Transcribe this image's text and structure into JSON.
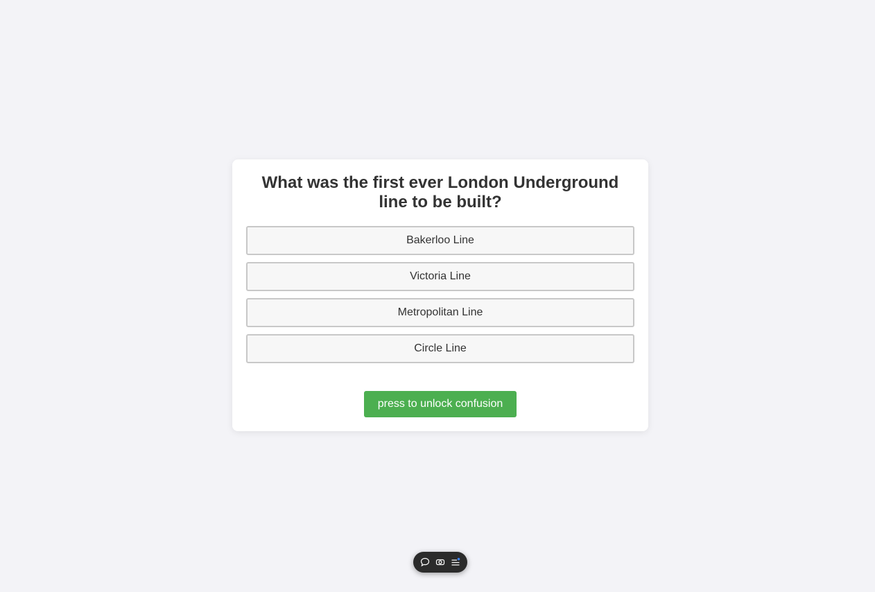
{
  "quiz": {
    "question": "What was the first ever London Underground line to be built?",
    "options": [
      "Bakerloo Line",
      "Victoria Line",
      "Metropolitan Line",
      "Circle Line"
    ],
    "unlock_button_label": "press to unlock confusion"
  },
  "toolbar": {
    "icons": [
      "chat-icon",
      "camera-icon",
      "menu-icon"
    ]
  },
  "colors": {
    "background": "#f3f3f7",
    "accent_button": "#4caf50",
    "toolbar_bg": "#2b2b2b",
    "notification_dot": "#3b82f6"
  }
}
